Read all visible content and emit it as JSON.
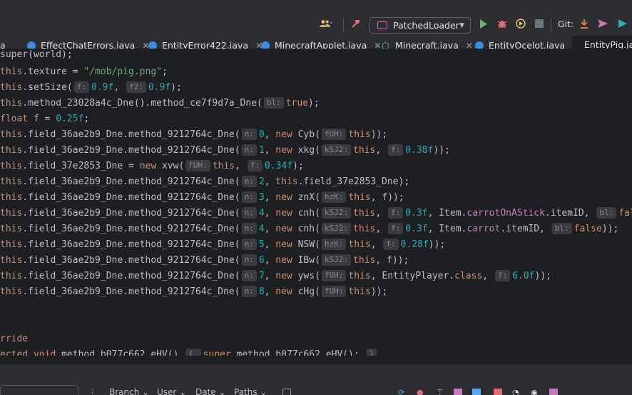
{
  "toolbar": {
    "run_config": "PatchedLoader",
    "git_label": "Git:"
  },
  "tabs": [
    {
      "label": "a",
      "type": "java",
      "active": false
    },
    {
      "label": "EffectChatErrors.java",
      "type": "java",
      "active": false
    },
    {
      "label": "EntityError422.java",
      "type": "java",
      "active": false
    },
    {
      "label": "MinecraftApplet.java",
      "type": "java",
      "active": false
    },
    {
      "label": "Minecraft.java",
      "type": "interface",
      "active": false
    },
    {
      "label": "EntityOcelot.java",
      "type": "java",
      "active": false
    },
    {
      "label": "EntityPig.ja",
      "type": "java",
      "active": true
    }
  ],
  "code": {
    "l0_a": "super(world);",
    "l1_a": "this",
    "l1_b": ".texture = ",
    "l1_c": "\"/mob/pig.png\"",
    "l1_d": ";",
    "l2_a": "this",
    "l2_b": ".setSize(",
    "l2_h1": "f:",
    "l2_c": "0.9f",
    "l2_d": ", ",
    "l2_h2": "f2:",
    "l2_e": "0.9f",
    "l2_f": ");",
    "l3_a": "this",
    "l3_b": ".method_23028a4c_Dne().method_ce7f9d7a_Dne(",
    "l3_h1": "bl:",
    "l3_c": "true",
    "l3_d": ");",
    "l4_a": "float",
    "l4_b": " f = ",
    "l4_c": "0.25f",
    "l4_d": ";",
    "l5_a": "this",
    "l5_b": ".field_36ae2b9_Dne.method_9212764c_Dne(",
    "l5_h1": "n:",
    "l5_c": "0",
    "l5_d": ", ",
    "l5_e": "new",
    "l5_f": " Cyb(",
    "l5_h2": "fUH:",
    "l5_g": "this",
    "l5_i": "));",
    "l6_a": "this",
    "l6_b": ".field_36ae2b9_Dne.method_9212764c_Dne(",
    "l6_h1": "n:",
    "l6_c": "1",
    "l6_d": ", ",
    "l6_e": "new",
    "l6_f": " xkg(",
    "l6_h2": "kSJ2:",
    "l6_g": "this",
    "l6_i": ", ",
    "l6_h3": "f:",
    "l6_j": "0.38f",
    "l6_k": "));",
    "l7_a": "this",
    "l7_b": ".field_37e2853_Dne = ",
    "l7_c": "new",
    "l7_d": " xvw(",
    "l7_h1": "fUH:",
    "l7_e": "this",
    "l7_f": ", ",
    "l7_h2": "f:",
    "l7_g": "0.34f",
    "l7_i": ");",
    "l8_a": "this",
    "l8_b": ".field_36ae2b9_Dne.method_9212764c_Dne(",
    "l8_h1": "n:",
    "l8_c": "2",
    "l8_d": ", ",
    "l8_e": "this",
    "l8_f": ".field_37e2853_Dne);",
    "l9_a": "this",
    "l9_b": ".field_36ae2b9_Dne.method_9212764c_Dne(",
    "l9_h1": "n:",
    "l9_c": "3",
    "l9_d": ", ",
    "l9_e": "new",
    "l9_f": " znX(",
    "l9_h2": "hzK:",
    "l9_g": "this",
    "l9_i": ", f));",
    "l10_a": "this",
    "l10_b": ".field_36ae2b9_Dne.method_9212764c_Dne(",
    "l10_h1": "n:",
    "l10_c": "4",
    "l10_d": ", ",
    "l10_e": "new",
    "l10_f": " cnh(",
    "l10_h2": "kSJ2:",
    "l10_g": "this",
    "l10_i": ", ",
    "l10_h3": "f:",
    "l10_j": "0.3f",
    "l10_k": ", Item.",
    "l10_l": "carrotOnAStick",
    "l10_m": ".itemID, ",
    "l10_h4": "bl:",
    "l10_n": "fal",
    "l11_a": "this",
    "l11_b": ".field_36ae2b9_Dne.method_9212764c_Dne(",
    "l11_h1": "n:",
    "l11_c": "4",
    "l11_d": ", ",
    "l11_e": "new",
    "l11_f": " cnh(",
    "l11_h2": "kSJ2:",
    "l11_g": "this",
    "l11_i": ", ",
    "l11_h3": "f:",
    "l11_j": "0.3f",
    "l11_k": ", Item.",
    "l11_l": "carrot",
    "l11_m": ".itemID, ",
    "l11_h4": "bl:",
    "l11_n": "false",
    "l11_o": "));",
    "l12_a": "this",
    "l12_b": ".field_36ae2b9_Dne.method_9212764c_Dne(",
    "l12_h1": "n:",
    "l12_c": "5",
    "l12_d": ", ",
    "l12_e": "new",
    "l12_f": " NSW(",
    "l12_h2": "hzK:",
    "l12_g": "this",
    "l12_i": ", ",
    "l12_h3": "f:",
    "l12_j": "0.28f",
    "l12_k": "));",
    "l13_a": "this",
    "l13_b": ".field_36ae2b9_Dne.method_9212764c_Dne(",
    "l13_h1": "n:",
    "l13_c": "6",
    "l13_d": ", ",
    "l13_e": "new",
    "l13_f": " IBw(",
    "l13_h2": "kSJ2:",
    "l13_g": "this",
    "l13_i": ", f));",
    "l14_a": "this",
    "l14_b": ".field_36ae2b9_Dne.method_9212764c_Dne(",
    "l14_h1": "n:",
    "l14_c": "7",
    "l14_d": ", ",
    "l14_e": "new",
    "l14_f": " yws(",
    "l14_h2": "fUH:",
    "l14_g": "this",
    "l14_i": ", EntityPlayer.",
    "l14_j": "class",
    "l14_k": ", ",
    "l14_h3": "f:",
    "l14_l": "6.0f",
    "l14_m": "));",
    "l15_a": "this",
    "l15_b": ".field_36ae2b9_Dne.method_9212764c_Dne(",
    "l15_h1": "n:",
    "l15_c": "8",
    "l15_d": ", ",
    "l15_e": "new",
    "l15_f": " cHg(",
    "l15_h2": "fUH:",
    "l15_g": "this",
    "l15_i": "));",
    "l16_a": "rride",
    "l17_a": "ected void",
    "l17_b": " method_b077c662_eHV() ",
    "l17_c": "{ ",
    "l17_d": "super",
    "l17_e": ".method_b077c662_eHV(); ",
    "l17_f": "}"
  },
  "bottom": {
    "filters": [
      "Branch",
      "User",
      "Date",
      "Paths"
    ]
  },
  "colors": {
    "keyword": "#cf8e6d",
    "string": "#6aab73",
    "number": "#2aacb8",
    "field": "#c77dbb",
    "method": "#56a8f5",
    "accent": "#3574f0"
  }
}
